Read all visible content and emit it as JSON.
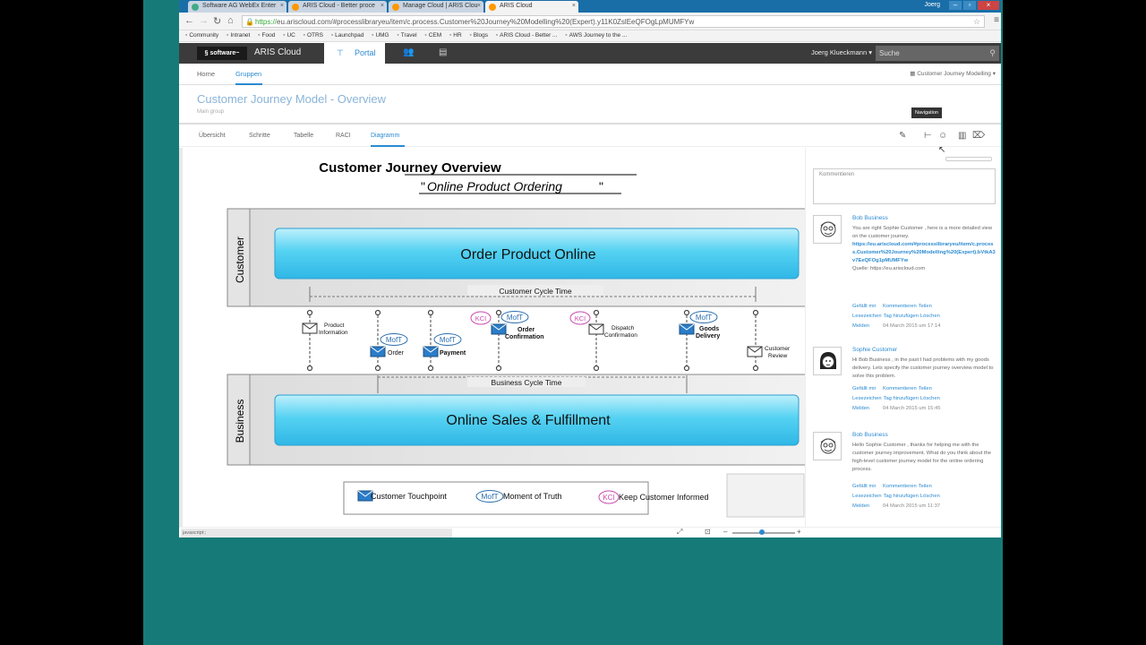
{
  "browser": {
    "tabs": [
      {
        "label": "Software AG WebEx Enter",
        "close": "×"
      },
      {
        "label": "ARIS Cloud - Better proce",
        "close": "×"
      },
      {
        "label": "Manage Cloud | ARIS Clou",
        "close": "×"
      },
      {
        "label": "ARIS Cloud",
        "close": "×"
      }
    ],
    "window_user": "Joerg",
    "url_scheme": "https://",
    "url_rest": "eu.ariscloud.com/#processlibraryeu/item/c.process.Customer%20Journey%20Modelling%20(Expert).y11K0ZslEeQFOgLpMUMFYw",
    "bookmarks": [
      "Community",
      "Intranet",
      "Food",
      "UC",
      "OTRS",
      "Launchpad",
      "UMG",
      "Travel",
      "CEM",
      "HR",
      "Blogs",
      "ARIS Cloud - Better ...",
      "AWS Journey to the ..."
    ]
  },
  "app": {
    "logo": "software",
    "product": "ARIS Cloud",
    "portal_label": "Portal",
    "user": "Joerg Klueckmann",
    "search_placeholder": "Suche",
    "subnav": [
      "Home",
      "Gruppen"
    ],
    "db_selector": "Customer Journey Modelling",
    "page_title": "Customer Journey Model - Overview",
    "page_subtitle": "Main group",
    "tabs": [
      "Übersicht",
      "Schritte",
      "Tabelle",
      "RACI",
      "Diagramm"
    ],
    "tooltip": "Navigation",
    "status_text": "javascript:;"
  },
  "diagram": {
    "title": "Customer Journey Overview",
    "subtitle_open": "\"",
    "subtitle": "Online Product Ordering",
    "subtitle_close": "\"",
    "lane_customer": "Customer",
    "lane_business": "Business",
    "customer_process": "Order Product Online",
    "business_process": "Online Sales & Fulfillment",
    "customer_cycle": "Customer Cycle Time",
    "business_cycle": "Business Cycle Time",
    "touchpoints": [
      {
        "label_1": "Product",
        "label_2": "Information"
      },
      {
        "label_1": "Order",
        "label_2": ""
      },
      {
        "label_1": "Payment",
        "label_2": ""
      },
      {
        "label_1": "Order",
        "label_2": "Confirmation"
      },
      {
        "label_1": "Dispatch",
        "label_2": "Confirmation"
      },
      {
        "label_1": "Goods",
        "label_2": "Delivery"
      },
      {
        "label_1": "Customer",
        "label_2": "Review"
      }
    ],
    "badge_moft": "MofT",
    "badge_kci": "KCI",
    "legend": [
      {
        "label": "Customer Touchpoint"
      },
      {
        "label": "Moment of Truth",
        "badge": "MofT"
      },
      {
        "label": "Keep Customer Informed",
        "badge": "KCI"
      }
    ]
  },
  "comments": {
    "placeholder": "Kommentieren",
    "items": [
      {
        "author": "Bob Business",
        "text_pre": "You are right Sophie Customer , here is a more detailed view on the customer journey.",
        "link": "https://eu.ariscloud.com/#processlibraryeu/item/c.process.Customer%20Journey%20Modelling%20(Expert).bVtkA3v7EeQFOg1pMUMFYw",
        "source": "Quelle: https://eu.ariscloud.com",
        "actions": [
          "Gefällt mir",
          "Kommentieren",
          "Teilen",
          "Lesezeichen",
          "Tag hinzufügen",
          "Löschen",
          "Melden"
        ],
        "date": "04 March 2015 um 17:14"
      },
      {
        "author": "Sophie Customer",
        "text_pre": "Hi Bob Business , in the past I had problems with my goods delivery. Lets specify the customer journey overview model to solve this problem.",
        "actions": [
          "Gefällt mir",
          "Kommentieren",
          "Teilen",
          "Lesezeichen",
          "Tag hinzufügen",
          "Löschen",
          "Melden"
        ],
        "date": "04 March 2015 um 15:45"
      },
      {
        "author": "Bob Business",
        "text_pre": "Hello Sophie Customer , thanks for helping me with the customer journey improvement. What do you think about the high-level customer journey model for the online ordering process.",
        "actions": [
          "Gefällt mir",
          "Kommentieren",
          "Teilen",
          "Lesezeichen",
          "Tag hinzufügen",
          "Löschen",
          "Melden"
        ],
        "date": "04 March 2015 um 11:37"
      }
    ]
  },
  "colors": {
    "teal": "#167b78",
    "accent": "#2b8ad1",
    "process_fill": "#4fd0f0",
    "lane_fill": "#e6e6e6"
  }
}
